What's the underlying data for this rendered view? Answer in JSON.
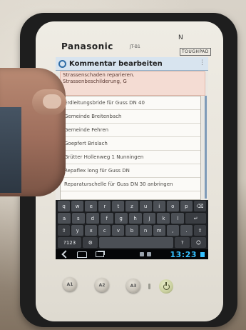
{
  "device": {
    "brand": "Panasonic",
    "model": "JT-B1",
    "badge": "TOUGHPAD",
    "nfc_mark": "N"
  },
  "screen": {
    "dialog_title": "Kommentar bearbeiten",
    "comment_lines": [
      "Strassenschaden reparieren.",
      "Strassenbeschilderung, G"
    ],
    "suggestions": [
      "Erdleitungsbride für Guss DN 40",
      "Gemeinde Breitenbach",
      "Gemeinde Fehren",
      "Goepfert Brislach",
      "Grütter Hollenweg 1 Nunningen",
      "Repaflex long für Guss DN",
      "Reparaturschelle für Guss DN 30 anbringen"
    ],
    "keyboard": {
      "row1": [
        "q",
        "w",
        "e",
        "r",
        "t",
        "z",
        "u",
        "i",
        "o",
        "p",
        "⌫"
      ],
      "row2": [
        "a",
        "s",
        "d",
        "f",
        "g",
        "h",
        "j",
        "k",
        "l",
        "↵"
      ],
      "row3": [
        "⇧",
        "y",
        "x",
        "c",
        "v",
        "b",
        "n",
        "m",
        ",",
        ".",
        "⇧"
      ],
      "row4": [
        "?123",
        "⚙",
        "",
        "?",
        "☺"
      ]
    },
    "clock": "13:23"
  },
  "hardware_buttons": [
    {
      "label": "A1"
    },
    {
      "label": "A2"
    },
    {
      "label": "A3"
    }
  ],
  "colors": {
    "clock": "#35c0ff",
    "dialog_accent": "#2f6da6",
    "comment_highlight": "#f4dcd3"
  }
}
